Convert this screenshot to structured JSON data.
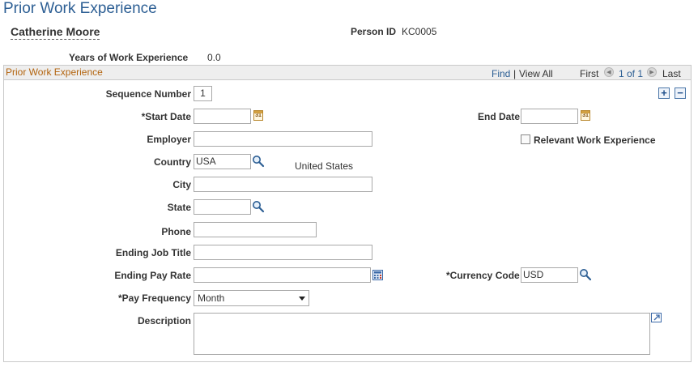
{
  "page": {
    "title": "Prior Work Experience",
    "person_name": "Catherine Moore",
    "person_id_label": "Person ID",
    "person_id": "KC0005",
    "years_label": "Years of Work Experience",
    "years_value": "0.0"
  },
  "section": {
    "title": "Prior Work Experience",
    "find": "Find",
    "separator": "|",
    "view_all": "View All",
    "first": "First",
    "count": "1 of 1",
    "last": "Last"
  },
  "icons": {
    "add": "+",
    "delete": "−",
    "calendar": "31",
    "prev": "◀",
    "next": "▶"
  },
  "form": {
    "sequence_label": "Sequence Number",
    "sequence_value": "1",
    "start_date_label": "*Start Date",
    "start_date_value": "",
    "end_date_label": "End Date",
    "end_date_value": "",
    "employer_label": "Employer",
    "employer_value": "",
    "relevant_label": "Relevant Work Experience",
    "country_label": "Country",
    "country_value": "USA",
    "country_desc": "United States",
    "city_label": "City",
    "city_value": "",
    "state_label": "State",
    "state_value": "",
    "phone_label": "Phone",
    "phone_value": "",
    "job_title_label": "Ending Job Title",
    "job_title_value": "",
    "pay_rate_label": "Ending Pay Rate",
    "pay_rate_value": "",
    "currency_label": "*Currency Code",
    "currency_value": "USD",
    "pay_freq_label": "*Pay Frequency",
    "pay_freq_value": "Month",
    "description_label": "Description",
    "description_value": ""
  },
  "colors": {
    "title": "#2d5f94",
    "section_title": "#b3640e",
    "link": "#2d5f94"
  }
}
